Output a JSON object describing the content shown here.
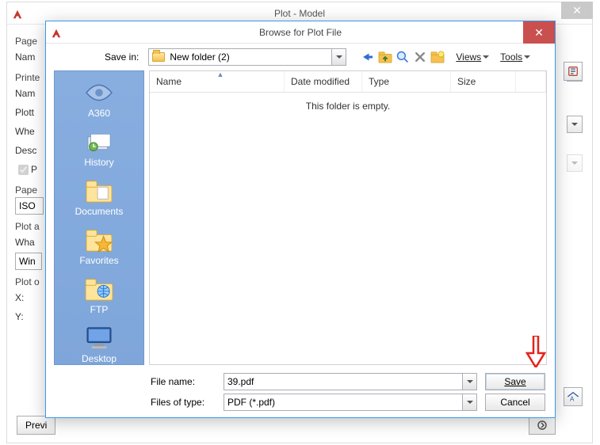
{
  "plot": {
    "title": "Plot - Model",
    "labels": {
      "page": "Page",
      "nam": "Nam",
      "printe": "Printe",
      "plott": "Plott",
      "whe": "Whe",
      "desc": "Desc",
      "p_chk": "P",
      "paper": "Pape",
      "plot_a": "Plot a",
      "wha": "Wha",
      "plot_o": "Plot o",
      "x": "X:",
      "y": "Y:",
      "preview": "Previ"
    },
    "paper_value": "ISO",
    "scale_value": "Win"
  },
  "modal": {
    "title": "Browse for Plot File",
    "savein_label": "Save in:",
    "savein_value": "New folder (2)",
    "views": "Views",
    "tools": "Tools",
    "columns": {
      "name": "Name",
      "date": "Date modified",
      "type": "Type",
      "size": "Size"
    },
    "empty": "This folder is empty.",
    "sidebar": [
      {
        "label": "A360",
        "key": "a360"
      },
      {
        "label": "History",
        "key": "history"
      },
      {
        "label": "Documents",
        "key": "documents"
      },
      {
        "label": "Favorites",
        "key": "favorites"
      },
      {
        "label": "FTP",
        "key": "ftp"
      },
      {
        "label": "Desktop",
        "key": "desktop"
      }
    ],
    "filename_label": "File name:",
    "filename_value": "39.pdf",
    "filetype_label": "Files of type:",
    "filetype_value": "PDF (*.pdf)",
    "save": "Save",
    "cancel": "Cancel"
  }
}
